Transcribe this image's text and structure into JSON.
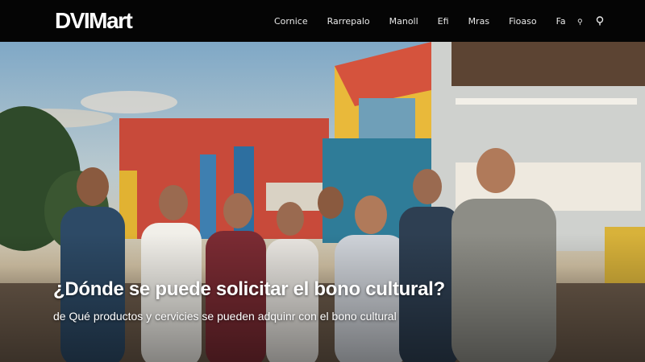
{
  "header": {
    "logo": "DVIMart",
    "nav": [
      "Cornice",
      "Rarrepalo",
      "Manoll",
      "Efi",
      "Mras",
      "Fioaso",
      "Fa"
    ],
    "icons": [
      "settings-icon",
      "search-icon"
    ]
  },
  "hero": {
    "title": "¿Dónde se puede solicitar el bono cultural?",
    "subtitle": "de Qué productos y cervicies se pueden adquinr con el bono cultural"
  },
  "colors": {
    "header_bg": "#050505",
    "text": "#ffffff"
  }
}
